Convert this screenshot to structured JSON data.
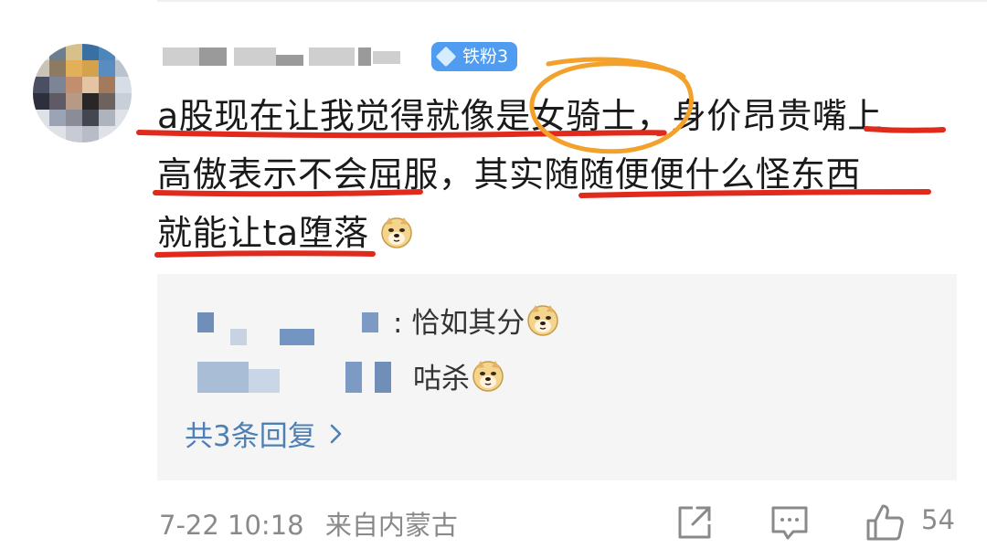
{
  "comment": {
    "badge": {
      "label": "铁粉3",
      "icon": "diamond-icon",
      "color": "#4f9cf0"
    },
    "lines": [
      "a股现在让我觉得就像是女骑士，身价昂贵嘴上",
      "高傲表示不会屈服，其实随随便便什么怪东西",
      "就能让ta堕落"
    ],
    "emoji": "doge-emoji",
    "annotation_color": "#e02a1b",
    "circle_color": "#f3a12a"
  },
  "replies": [
    {
      "text": ": 恰如其分",
      "emoji": "doge-emoji"
    },
    {
      "text": "咕杀",
      "emoji": "doge-emoji"
    }
  ],
  "more_replies": {
    "label": "共3条回复",
    "icon": "chevron-right-icon",
    "color": "#4f80b5"
  },
  "footer": {
    "date": "7-22 10:18",
    "source": "来自内蒙古",
    "like_count": "54"
  }
}
